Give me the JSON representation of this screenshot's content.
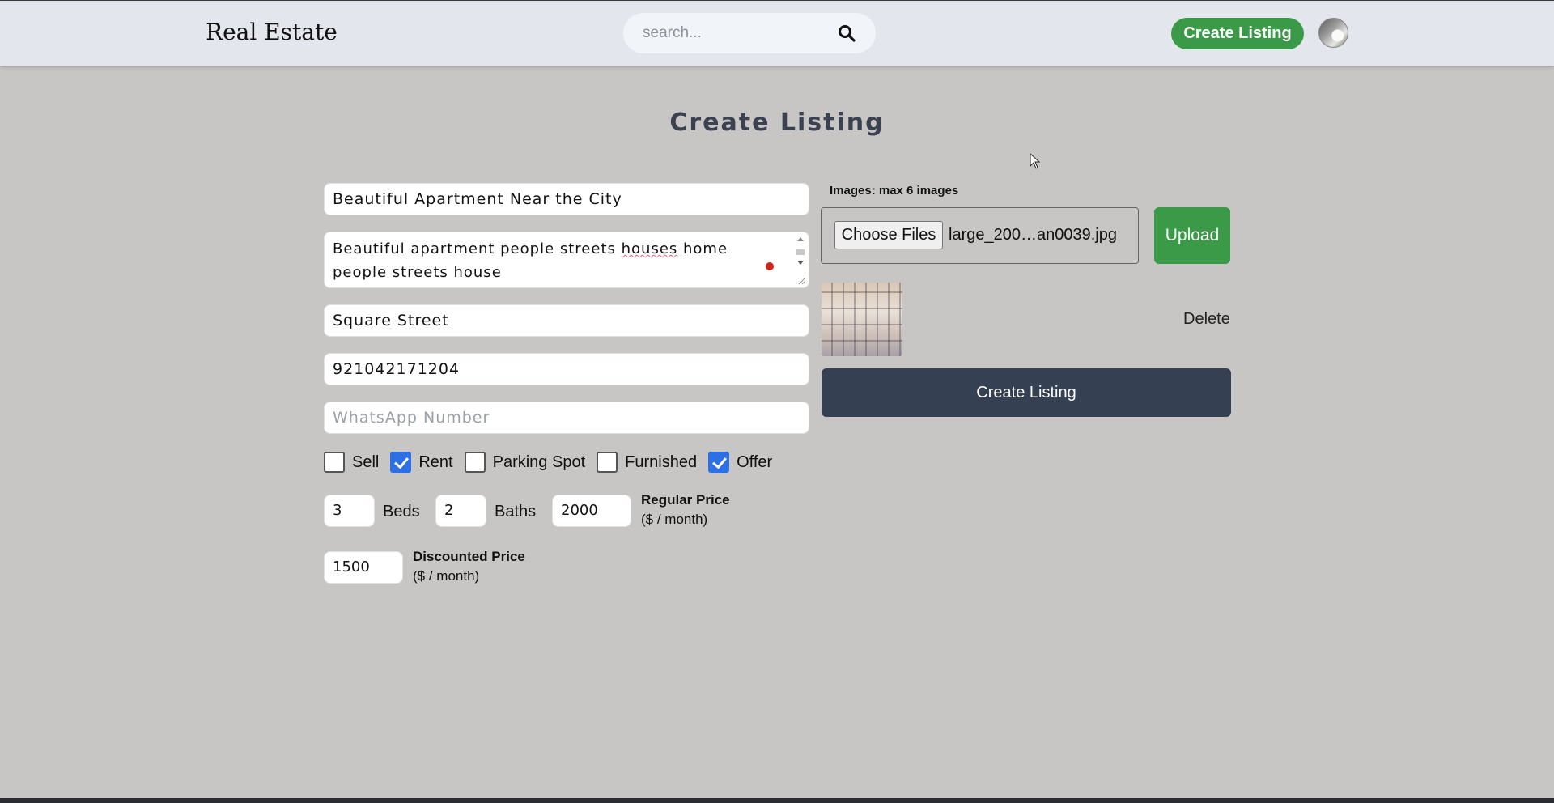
{
  "header": {
    "brand": "Real Estate",
    "search_placeholder": "search...",
    "create_listing_label": "Create Listing"
  },
  "page": {
    "title": "Create Listing"
  },
  "form": {
    "name": "Beautiful Apartment Near the City",
    "description_before": "Beautiful apartment people streets ",
    "description_misspelled": "houses",
    "description_after": " home people streets house",
    "address": "Square Street",
    "phone": "921042171204",
    "whatsapp_placeholder": "WhatsApp Number",
    "checkboxes": [
      {
        "label": "Sell",
        "checked": false
      },
      {
        "label": "Rent",
        "checked": true
      },
      {
        "label": "Parking Spot",
        "checked": false
      },
      {
        "label": "Furnished",
        "checked": false
      },
      {
        "label": "Offer",
        "checked": true
      }
    ],
    "beds_value": "3",
    "beds_label": "Beds",
    "baths_value": "2",
    "baths_label": "Baths",
    "regular_price_value": "2000",
    "regular_price_label": "Regular Price",
    "regular_price_unit": "($ / month)",
    "discounted_price_value": "1500",
    "discounted_price_label": "Discounted Price",
    "discounted_price_unit": "($ / month)"
  },
  "images": {
    "label": "Images: max 6 images",
    "choose_files_label": "Choose Files",
    "file_name": "large_200…an0039.jpg",
    "upload_label": "Upload",
    "delete_label": "Delete"
  },
  "submit": {
    "label": "Create Listing"
  },
  "colors": {
    "background": "#c8c6c4",
    "header": "#e3e6ec",
    "green": "#3a9a48",
    "dark_button": "#354052",
    "checkbox_checked": "#2f6fe4"
  }
}
